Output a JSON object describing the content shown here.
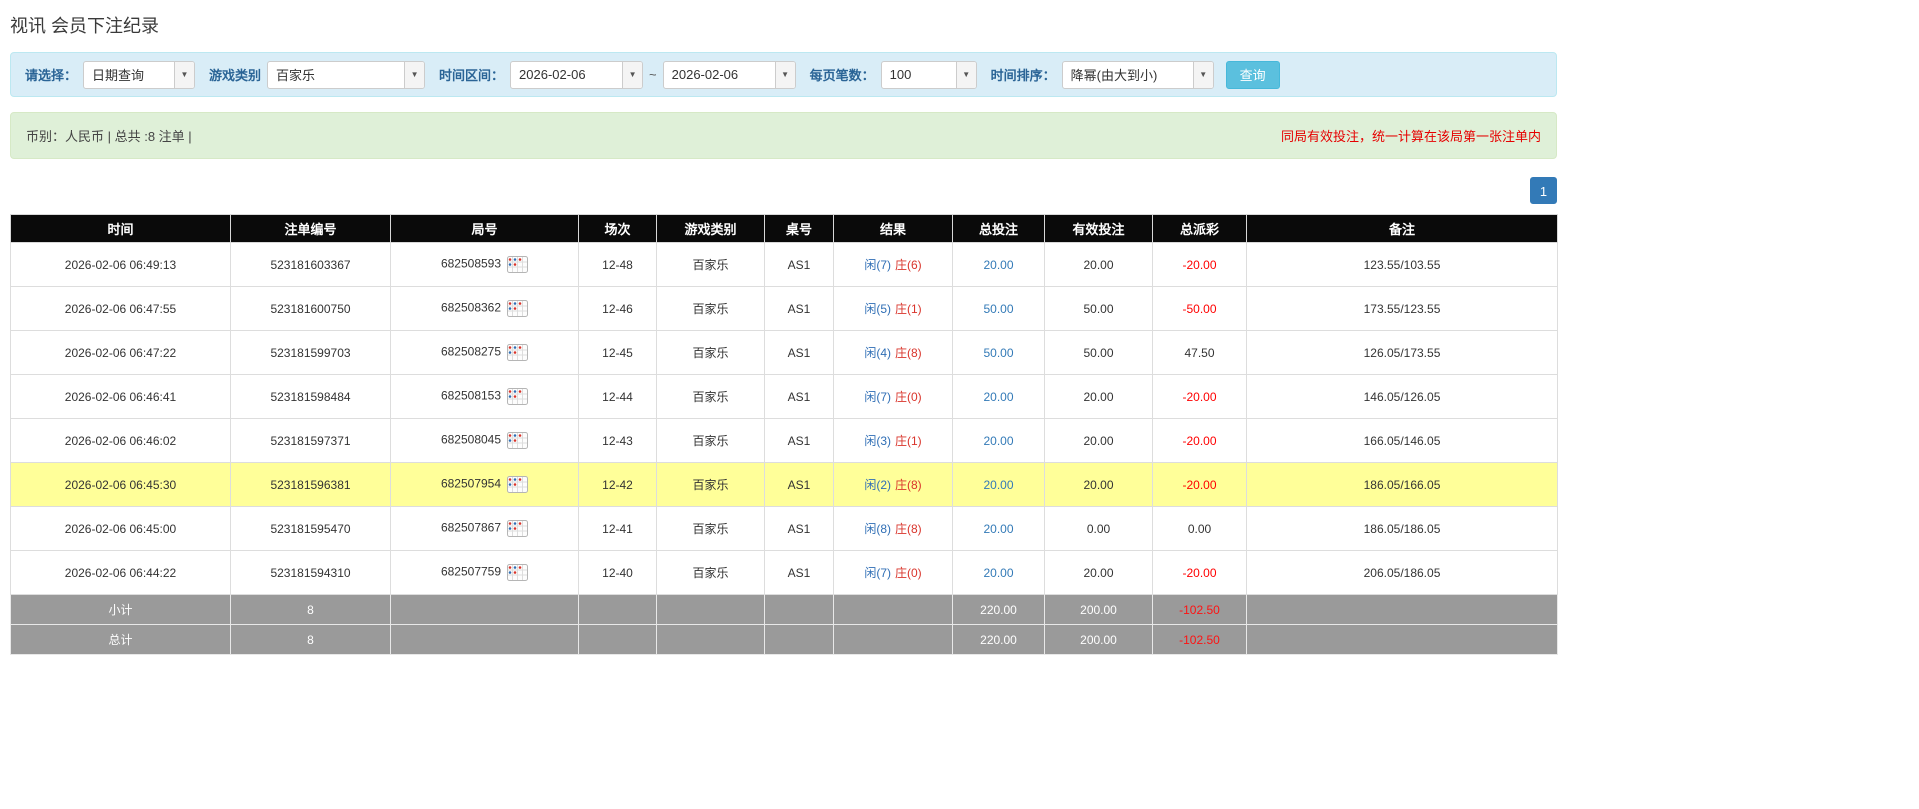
{
  "page": {
    "title": "视讯 会员下注纪录"
  },
  "filters": {
    "select_label": "请选择：",
    "select_value": "日期查询",
    "game_type_label": "游戏类别",
    "game_type_value": "百家乐",
    "time_range_label": "时间区间：",
    "date_from": "2026-02-06",
    "range_separator": "~",
    "date_to": "2026-02-06",
    "page_size_label": "每页笔数：",
    "page_size_value": "100",
    "sort_label": "时间排序：",
    "sort_value": "降幂(由大到小)",
    "search_button": "查询"
  },
  "info_bar": {
    "summary": "币别：人民币 | 总共 :8 注单 |",
    "notice": "同局有效投注，统一计算在该局第一张注单内"
  },
  "pagination": {
    "current_page": "1"
  },
  "table": {
    "headers": [
      "时间",
      "注单编号",
      "局号",
      "场次",
      "游戏类别",
      "桌号",
      "结果",
      "总投注",
      "有效投注",
      "总派彩",
      "备注"
    ],
    "rows": [
      {
        "time": "2026-02-06 06:49:13",
        "bet_id": "523181603367",
        "round_id": "682508593",
        "session": "12-48",
        "game": "百家乐",
        "table_no": "AS1",
        "result_player": "闲(7)",
        "result_banker": "庄(6)",
        "total_bet": "20.00",
        "valid_bet": "20.00",
        "payout": "-20.00",
        "remark": "123.55/103.55",
        "highlight": false
      },
      {
        "time": "2026-02-06 06:47:55",
        "bet_id": "523181600750",
        "round_id": "682508362",
        "session": "12-46",
        "game": "百家乐",
        "table_no": "AS1",
        "result_player": "闲(5)",
        "result_banker": "庄(1)",
        "total_bet": "50.00",
        "valid_bet": "50.00",
        "payout": "-50.00",
        "remark": "173.55/123.55",
        "highlight": false
      },
      {
        "time": "2026-02-06 06:47:22",
        "bet_id": "523181599703",
        "round_id": "682508275",
        "session": "12-45",
        "game": "百家乐",
        "table_no": "AS1",
        "result_player": "闲(4)",
        "result_banker": "庄(8)",
        "total_bet": "50.00",
        "valid_bet": "50.00",
        "payout": "47.50",
        "remark": "126.05/173.55",
        "highlight": false
      },
      {
        "time": "2026-02-06 06:46:41",
        "bet_id": "523181598484",
        "round_id": "682508153",
        "session": "12-44",
        "game": "百家乐",
        "table_no": "AS1",
        "result_player": "闲(7)",
        "result_banker": "庄(0)",
        "total_bet": "20.00",
        "valid_bet": "20.00",
        "payout": "-20.00",
        "remark": "146.05/126.05",
        "highlight": false
      },
      {
        "time": "2026-02-06 06:46:02",
        "bet_id": "523181597371",
        "round_id": "682508045",
        "session": "12-43",
        "game": "百家乐",
        "table_no": "AS1",
        "result_player": "闲(3)",
        "result_banker": "庄(1)",
        "total_bet": "20.00",
        "valid_bet": "20.00",
        "payout": "-20.00",
        "remark": "166.05/146.05",
        "highlight": false
      },
      {
        "time": "2026-02-06 06:45:30",
        "bet_id": "523181596381",
        "round_id": "682507954",
        "session": "12-42",
        "game": "百家乐",
        "table_no": "AS1",
        "result_player": "闲(2)",
        "result_banker": "庄(8)",
        "total_bet": "20.00",
        "valid_bet": "20.00",
        "payout": "-20.00",
        "remark": "186.05/166.05",
        "highlight": true
      },
      {
        "time": "2026-02-06 06:45:00",
        "bet_id": "523181595470",
        "round_id": "682507867",
        "session": "12-41",
        "game": "百家乐",
        "table_no": "AS1",
        "result_player": "闲(8)",
        "result_banker": "庄(8)",
        "total_bet": "20.00",
        "valid_bet": "0.00",
        "payout": "0.00",
        "remark": "186.05/186.05",
        "highlight": false
      },
      {
        "time": "2026-02-06 06:44:22",
        "bet_id": "523181594310",
        "round_id": "682507759",
        "session": "12-40",
        "game": "百家乐",
        "table_no": "AS1",
        "result_player": "闲(7)",
        "result_banker": "庄(0)",
        "total_bet": "20.00",
        "valid_bet": "20.00",
        "payout": "-20.00",
        "remark": "206.05/186.05",
        "highlight": false
      }
    ],
    "footer": [
      {
        "label": "小计",
        "count": "8",
        "total_bet": "220.00",
        "valid_bet": "200.00",
        "payout": "-102.50"
      },
      {
        "label": "总计",
        "count": "8",
        "total_bet": "220.00",
        "valid_bet": "200.00",
        "payout": "-102.50"
      }
    ]
  },
  "colors": {
    "accent_blue": "#337ab7",
    "player_blue": "#2f6eb5",
    "banker_red": "#d9342b",
    "negative_red": "#ff0000",
    "highlight_yellow": "#ffff99",
    "header_black": "#0a0a0a",
    "footer_gray": "#9a9a9a",
    "filter_bar_blue": "#d9edf7",
    "info_bar_green": "#dff0d8"
  }
}
